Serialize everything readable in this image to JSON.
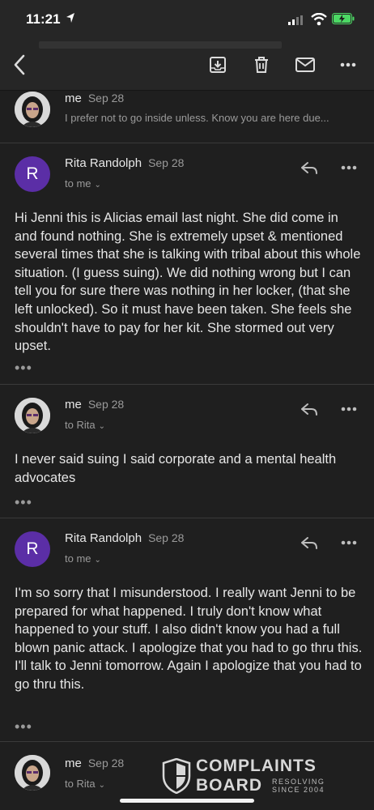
{
  "status_bar": {
    "time": "11:21"
  },
  "toolbar": {
    "back_icon": "chevron-left-icon",
    "archive_icon": "archive-icon",
    "delete_icon": "trash-icon",
    "mark_unread_icon": "envelope-icon",
    "more_icon": "more-horizontal-icon"
  },
  "collapsed_message": {
    "sender": "me",
    "date": "Sep 28",
    "snippet": "I prefer not to go inside unless. Know you are here due..."
  },
  "messages": [
    {
      "sender": "Rita Randolph",
      "date": "Sep 28",
      "to": "to me",
      "avatar_letter": "R",
      "body": "Hi Jenni this is Alicias email last night. She did come in and found nothing. She is extremely upset & mentioned several times that she is talking with tribal about this whole situation. (I guess suing). We did nothing wrong but I can tell you for sure there was nothing in her locker, (that she left unlocked). So it must have been taken. She feels she shouldn't have to pay for her kit. She stormed out very upset.",
      "ellipsis": "•••"
    },
    {
      "sender": "me",
      "date": "Sep 28",
      "to": "to Rita",
      "body": "I never said suing I said corporate and a mental health advocates",
      "ellipsis": "•••"
    },
    {
      "sender": "Rita Randolph",
      "date": "Sep 28",
      "to": "to me",
      "avatar_letter": "R",
      "body": "I'm so sorry that I misunderstood. I really want Jenni to be prepared for what happened. I truly don't know what happened to your stuff. I also didn't know you had a full blown panic attack. I apologize that you had to go thru this. I'll talk to Jenni tomorrow. Again I apologize that you had to go thru this.",
      "ellipsis": "•••"
    },
    {
      "sender": "me",
      "date": "Sep 28",
      "to": "to Rita"
    }
  ],
  "watermark": {
    "line1": "COMPLAINTS",
    "line2": "BOARD",
    "tagline": "RESOLVING SINCE 2004"
  },
  "colors": {
    "accent_avatar": "#5b2ea6",
    "background": "#1f1f1f",
    "battery": "#4cd964"
  }
}
